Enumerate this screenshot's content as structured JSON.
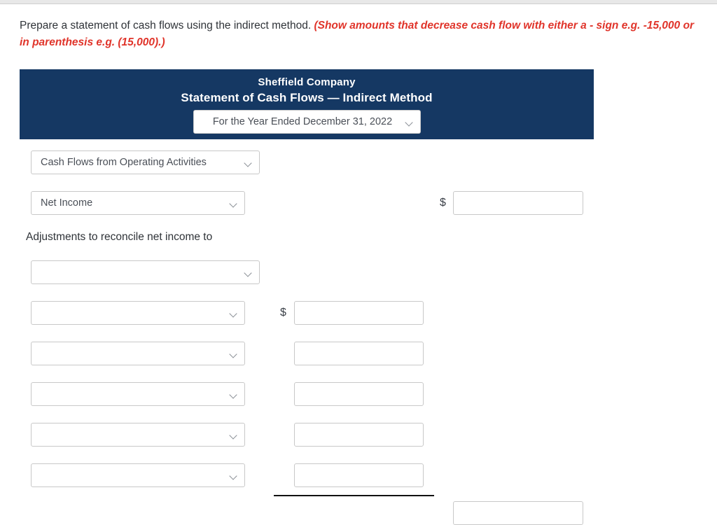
{
  "instructions": {
    "main_text": "Prepare a statement of cash flows using the indirect method.",
    "emphasis_text": "(Show amounts that decrease cash flow with either a - sign e.g. -15,000 or in parenthesis e.g. (15,000).)",
    "emphasis_color": "#e0342a"
  },
  "statement_header": {
    "company_name": "Sheffield Company",
    "statement_title": "Statement of Cash Flows — Indirect Method",
    "background_color": "#153863",
    "period_select": {
      "value": "For the Year Ended December 31, 2022",
      "icon": "chevron-down-icon"
    }
  },
  "body": {
    "section_select": {
      "value": "Cash Flows from Operating Activities",
      "icon": "chevron-down-icon"
    },
    "net_income_select": {
      "value": "Net Income",
      "icon": "chevron-down-icon"
    },
    "net_income_amount": {
      "currency_symbol": "$",
      "value": "",
      "placeholder": ""
    },
    "adjustments_label": "Adjustments to reconcile net income to",
    "adjustment_rows": [
      {
        "select_value": "",
        "icon": "chevron-down-icon",
        "currency_symbol": "",
        "amount_value": ""
      },
      {
        "select_value": "",
        "icon": "chevron-down-icon",
        "currency_symbol": "$",
        "amount_value": ""
      },
      {
        "select_value": "",
        "icon": "chevron-down-icon",
        "currency_symbol": "",
        "amount_value": ""
      },
      {
        "select_value": "",
        "icon": "chevron-down-icon",
        "currency_symbol": "",
        "amount_value": ""
      },
      {
        "select_value": "",
        "icon": "chevron-down-icon",
        "currency_symbol": "",
        "amount_value": ""
      },
      {
        "select_value": "",
        "icon": "chevron-down-icon",
        "currency_symbol": "",
        "amount_value": ""
      }
    ],
    "subtotal_amount": {
      "value": "",
      "placeholder": ""
    }
  }
}
